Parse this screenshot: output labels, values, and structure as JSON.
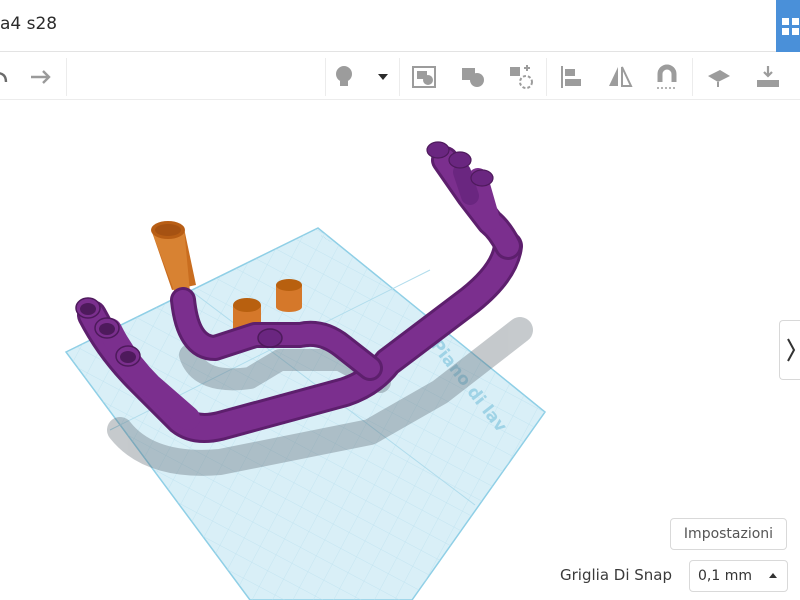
{
  "window": {
    "title": "a4 s28"
  },
  "toolbar": {
    "icons": [
      "undo-icon",
      "redo-icon",
      "lightbulb-icon",
      "dropdown-caret-icon",
      "group-icon",
      "ungroup-icon",
      "align-shapes-icon",
      "align-icon",
      "mirror-icon",
      "magnet-icon",
      "workplane-icon",
      "ruler-icon"
    ]
  },
  "workplane": {
    "label": "Piano di lav"
  },
  "side_panel": {
    "toggle_icon": "chevron-right-icon"
  },
  "settings": {
    "label": "Impostazioni"
  },
  "snap": {
    "label": "Griglia Di Snap",
    "value": "0,1 mm"
  },
  "colors": {
    "accent": "#4a90d9",
    "pipe": "#7b2f8e",
    "pipe_dark": "#5d1f6d",
    "orange": "#d5782a",
    "workplane": "#cfe9f3",
    "grid_line": "#8fcfe6"
  }
}
